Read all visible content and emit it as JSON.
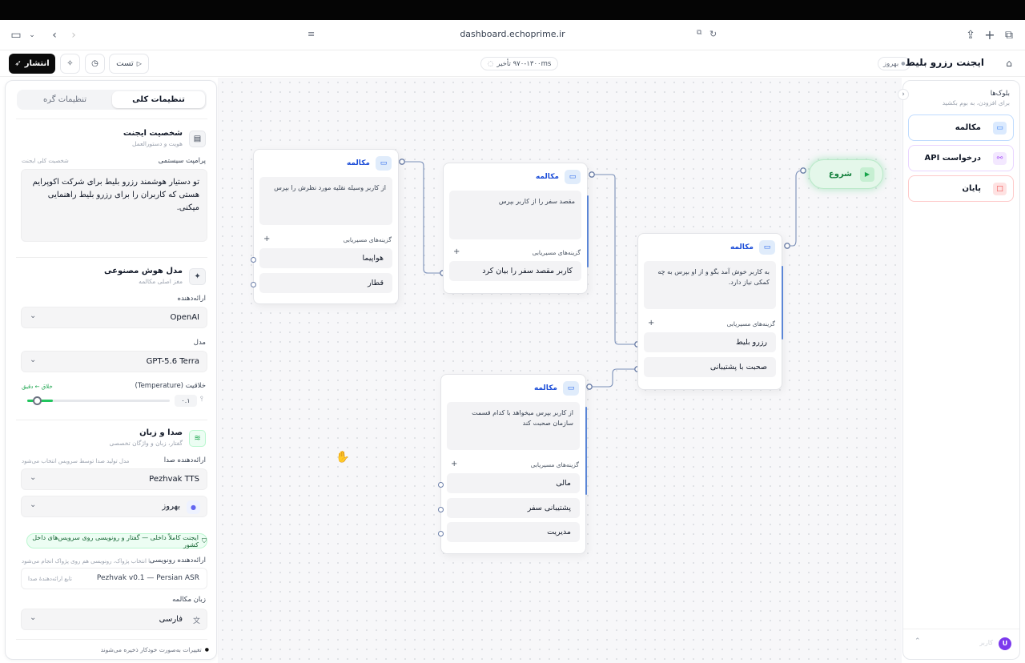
{
  "browser": {
    "url": "dashboard.echoprime.ir"
  },
  "toolbar": {
    "publish_label": "انتشار",
    "test_label": "تست",
    "status_text": "۹۷۰-۱۳۰۰ms تأخیر",
    "page_title": "ایجنت رزرو بلیط",
    "updated_text": "بهروز"
  },
  "left_panel": {
    "tabs": [
      "تنظیمات کلی",
      "تنظیمات گره"
    ],
    "personality": {
      "title": "شخصیت ایجنت",
      "subtitle": "هویت و دستورالعمل",
      "prompt_label": "پرامپت سیستمی",
      "prompt_hint": "شخصیت کلی ایجنت",
      "prompt_text": "تو دستیار هوشمند رزرو بلیط برای شرکت اکوپرایم هستی که کاربران را برای رزرو بلیط راهنمایی میکنی."
    },
    "ai_model": {
      "title": "مدل هوش مصنوعی",
      "subtitle": "مغز اصلی مکالمه",
      "provider_label": "ارائه‌دهنده",
      "provider_value": "OpenAI",
      "model_label": "مدل",
      "model_value": "GPT-5.6 Terra",
      "temperature_label": "خلاقیت (Temperature)",
      "temperature_hint": "خلاق ← دقیق",
      "temperature_value": "۰.۱",
      "temperature_level": 0.04
    },
    "voice": {
      "title": "صدا و زبان",
      "subtitle": "گفتار، زبان و واژگان تخصصی",
      "voice_provider_label": "ارائه‌دهنده صدا",
      "voice_provider_hint": "مدل تولید صدا توسط سرویس انتخاب می‌شود",
      "voice_provider_value": "Pezhvak TTS",
      "voice_value": "بهروز",
      "internal_badge": "ایجنت کاملاً داخلی — گفتار و رونویسی روی سرویس‌های داخل کشور",
      "asr_label": "ارائه‌دهنده رونویسی",
      "asr_hint": "با انتخاب پژواک، رونویسی هم روی پژواک انجام می‌شود",
      "asr_value": "Pezhvak v0.1 — Persian ASR",
      "asr_note": "تابع ارائه‌دهندهٔ صدا",
      "language_label": "زبان مکالمه",
      "language_value": "فارسی"
    },
    "footer_note": "تغییرات به‌صورت خودکار ذخیره می‌شوند"
  },
  "right_panel": {
    "title": "بلوک‌ها",
    "subtitle": "برای افزودن، به بوم بکشید",
    "blocks": [
      {
        "label": "مکالمه",
        "icon": "chat-icon",
        "color": "#3b82f6"
      },
      {
        "label": "درخواست API",
        "icon": "webhook-icon",
        "color": "#a855f7"
      },
      {
        "label": "پایان",
        "icon": "stop-icon",
        "color": "#ef4444"
      }
    ],
    "chat_avatar": "U",
    "chat_placeholder": "کاربر"
  },
  "nodes": {
    "start": {
      "label": "شروع"
    },
    "welcome": {
      "title": "مکالمه",
      "message": "به کاربر خوش آمد بگو و از او بپرس به چه کمکی نیاز دارد.",
      "routes_label": "گزینه‌های مسیریابی",
      "routes": [
        "رزرو بلیط",
        "صحبت با پشتیبانی"
      ]
    },
    "destination": {
      "title": "مکالمه",
      "message": "مقصد سفر را از کاربر بپرس",
      "routes_label": "گزینه‌های مسیریابی",
      "routes": [
        "کاربر مقصد سفر را بیان کرد"
      ]
    },
    "vehicle": {
      "title": "مکالمه",
      "message": "از کاربر وسیله نقلیه مورد نظرش را بپرس",
      "routes_label": "گزینه‌های مسیریابی",
      "routes": [
        "هواپیما",
        "قطار"
      ]
    },
    "support": {
      "title": "مکالمه",
      "message": "از کاربر بپرس میخواهد با کدام قسمت سازمان صحبت کند",
      "routes_label": "گزینه‌های مسیریابی",
      "routes": [
        "مالی",
        "پشتیبانی سفر",
        "مدیریت"
      ]
    }
  }
}
